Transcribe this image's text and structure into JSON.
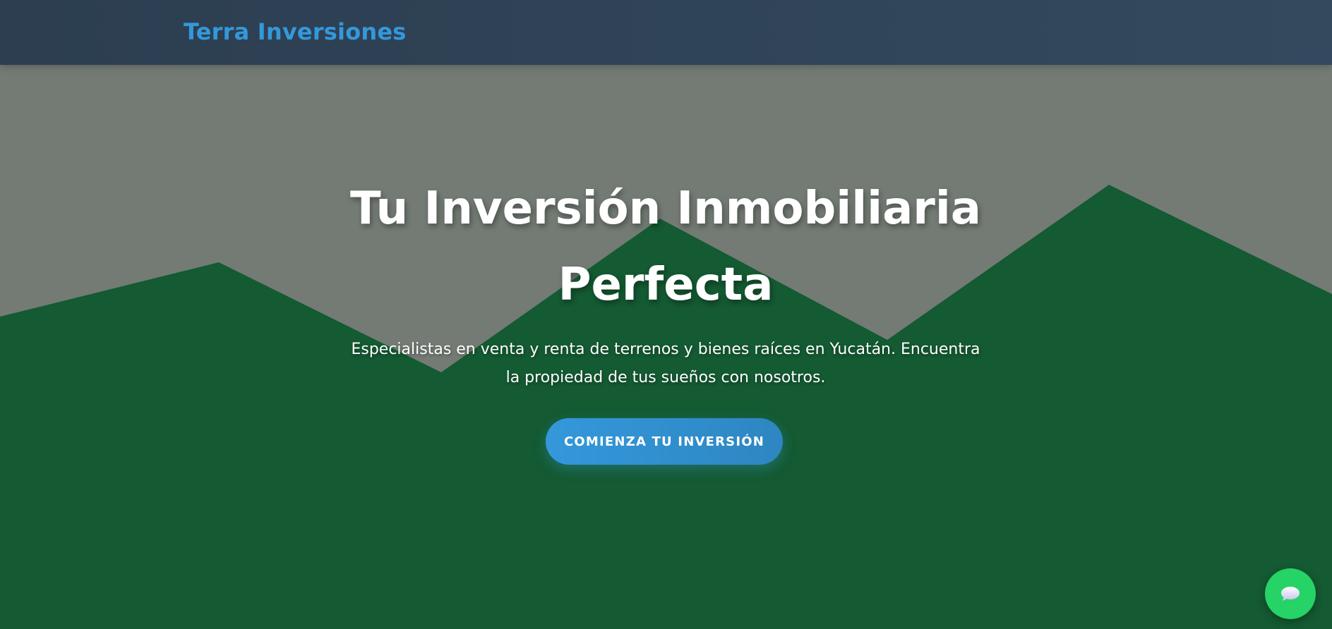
{
  "navbar": {
    "brand": "Terra Inversiones"
  },
  "hero": {
    "title": "Tu Inversión Inmobiliaria Perfecta",
    "subtitle": "Especialistas en venta y renta de terrenos y bienes raíces en Yucatán. Encuentra la propiedad de tus sueños con nosotros.",
    "cta_label": "COMIENZA TU INVERSIÓN"
  },
  "chat_widget": {
    "icon": "chat-bubble-icon"
  },
  "colors": {
    "navbar_start": "#2c3e50",
    "navbar_end": "#34495e",
    "brand": "#3498db",
    "sky": "#737b74",
    "mountains": "#145a32",
    "cta": "#3498db",
    "chat": "#25d366"
  }
}
